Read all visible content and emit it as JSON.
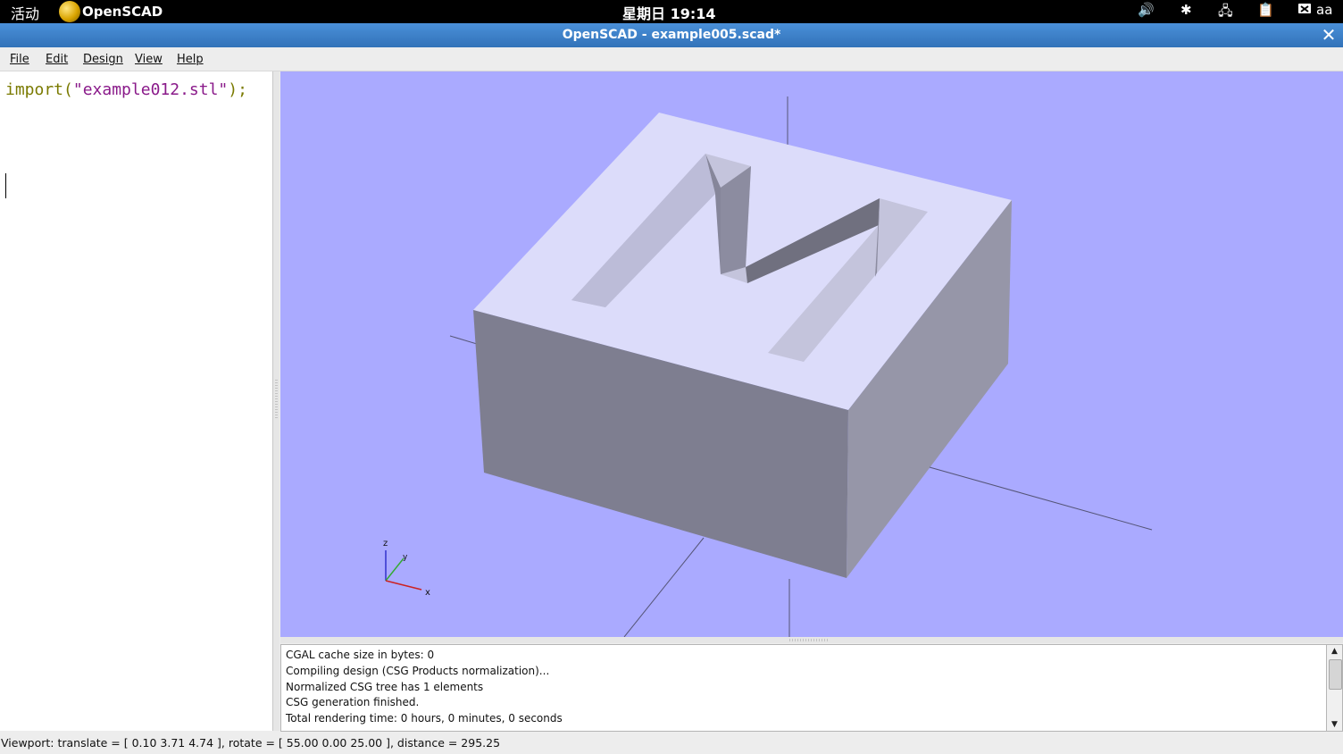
{
  "topbar": {
    "activities": "活动",
    "app_name": "OpenSCAD",
    "clock": "星期日 19:14",
    "tray": {
      "volume": "🔊",
      "bluetooth": "✱",
      "network": "🖧",
      "clipboard": "📋",
      "input_method": "aa"
    }
  },
  "window": {
    "title": "OpenSCAD - example005.scad*",
    "close_glyph": "✕"
  },
  "menu": {
    "file": "File",
    "edit": "Edit",
    "design": "Design",
    "view": "View",
    "help": "Help"
  },
  "editor": {
    "code_keyword": "import",
    "code_open": "(",
    "code_string": "\"example012.stl\"",
    "code_close": ");"
  },
  "viewport": {
    "background_color": "#aaaaff",
    "axis_labels": {
      "z": "z",
      "y": "y",
      "x": "x"
    },
    "model_letter": "M"
  },
  "console": {
    "lines": [
      "CGAL cache size in bytes: 0",
      "Compiling design (CSG Products normalization)...",
      "Normalized CSG tree has 1 elements",
      "CSG generation finished.",
      "Total rendering time: 0 hours, 0 minutes, 0 seconds"
    ]
  },
  "scrollbar": {
    "up": "▲",
    "down": "▼"
  },
  "status": {
    "text": "Viewport: translate = [ 0.10 3.71 4.74 ], rotate = [ 55.00 0.00 25.00 ], distance = 295.25"
  }
}
